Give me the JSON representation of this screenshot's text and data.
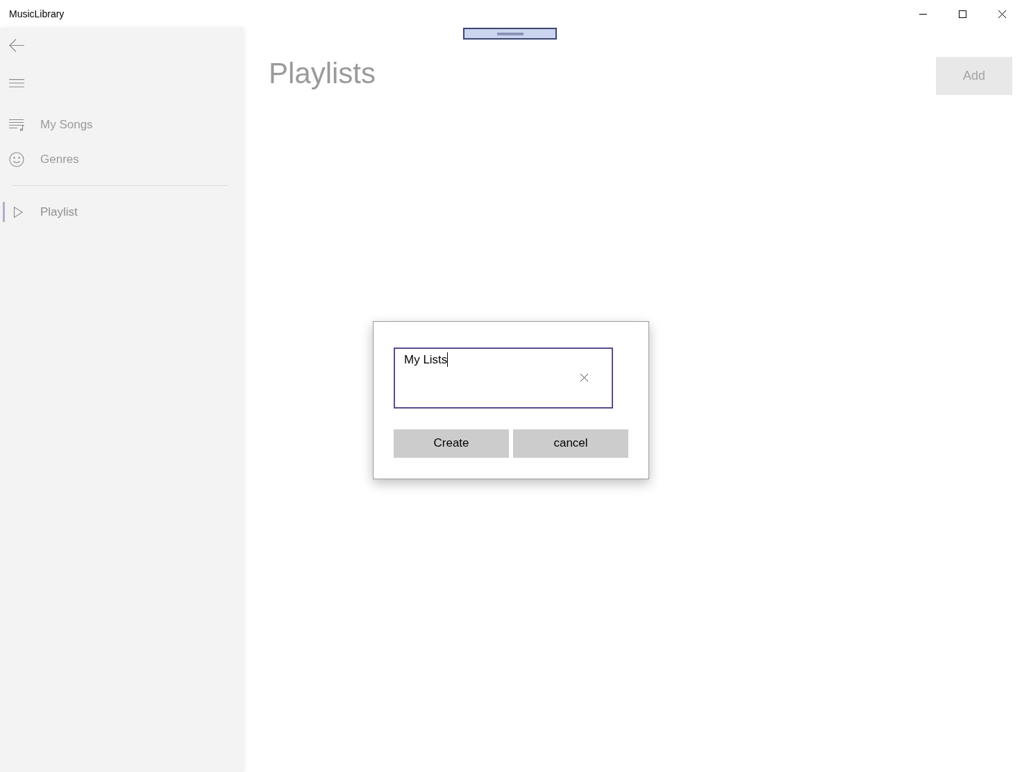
{
  "window": {
    "title": "MusicLibrary"
  },
  "sidebar": {
    "items": [
      {
        "kind": "songs",
        "label": "My Songs",
        "selected": false
      },
      {
        "kind": "genres",
        "label": "Genres",
        "selected": false
      }
    ],
    "secondary_items": [
      {
        "kind": "playlist",
        "label": "Playlist",
        "selected": true
      }
    ]
  },
  "page": {
    "title": "Playlists",
    "add_button": {
      "label": "Add",
      "disabled": true
    }
  },
  "dialog": {
    "input": {
      "value": "My Lists",
      "focused": true
    },
    "buttons": [
      {
        "label": "Create"
      },
      {
        "label": "cancel"
      }
    ]
  }
}
